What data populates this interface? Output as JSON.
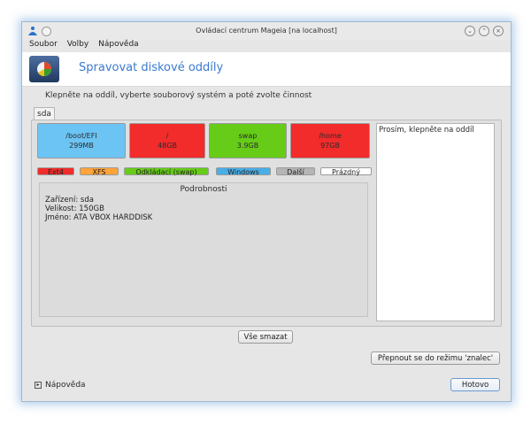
{
  "window": {
    "title": "Ovládací centrum Mageia  [na localhost]"
  },
  "menu": {
    "items": [
      "Soubor",
      "Volby",
      "Nápověda"
    ]
  },
  "header": {
    "title": "Spravovat diskové oddíly"
  },
  "instruction": "Klepněte na oddíl, vyberte souborový systém a poté zvolte činnost",
  "tabs": [
    "sda"
  ],
  "partitions": [
    {
      "name": "/boot/EFI",
      "size": "299MB",
      "color": "#6cc4f4"
    },
    {
      "name": "/",
      "size": "48GB",
      "color": "#f22b2b"
    },
    {
      "name": "swap",
      "size": "3.9GB",
      "color": "#66cc18"
    },
    {
      "name": "/home",
      "size": "97GB",
      "color": "#f22b2b"
    }
  ],
  "legend": [
    {
      "label": "Ext4",
      "color": "#f22b2b"
    },
    {
      "label": "XFS",
      "color": "#ffa33a"
    },
    {
      "label": "Odkládací (swap)",
      "color": "#66cc18"
    },
    {
      "label": "Windows",
      "color": "#48aee8"
    },
    {
      "label": "Další",
      "color": "#b5b5b5"
    },
    {
      "label": "Prázdný",
      "color": "#ffffff"
    }
  ],
  "details": {
    "title": "Podrobnosti",
    "lines": [
      "Zařízení: sda",
      "Velikost: 150GB",
      "Jméno: ATA VBOX HARDDISK"
    ]
  },
  "info_text": "Prosím, klepněte na oddíl",
  "buttons": {
    "clear_all": "Vše smazat",
    "expert_mode": "Přepnout se do režimu 'znalec'",
    "done": "Hotovo"
  },
  "help": {
    "label": "Nápověda"
  }
}
